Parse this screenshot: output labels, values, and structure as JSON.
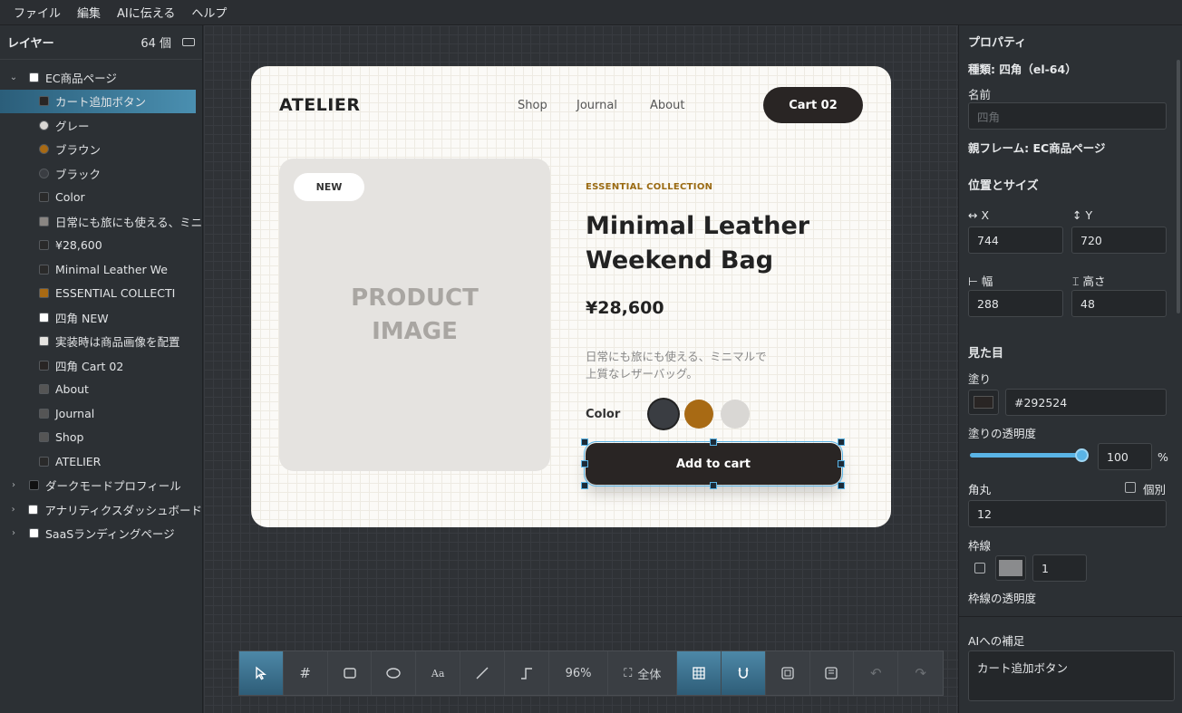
{
  "menu": [
    "ファイル",
    "編集",
    "AIに伝える",
    "ヘルプ"
  ],
  "layers": {
    "title": "レイヤー",
    "count": "64 個",
    "items": [
      {
        "label": "EC商品ページ",
        "level": 0,
        "expanded": true,
        "color": "#ffffff"
      },
      {
        "label": "カート追加ボタン",
        "level": 1,
        "selected": true,
        "color": "#292524"
      },
      {
        "label": "グレー",
        "level": 1,
        "color": "#d9d7d4",
        "round": true
      },
      {
        "label": "ブラウン",
        "level": 1,
        "color": "#a86a14",
        "round": true
      },
      {
        "label": "ブラック",
        "level": 1,
        "color": "#3a3d42",
        "round": true
      },
      {
        "label": "Color",
        "level": 1,
        "color": "#2a2a2a"
      },
      {
        "label": "日常にも旅にも使える、ミニマ",
        "level": 1,
        "color": "#8a8683"
      },
      {
        "label": "¥28,600",
        "level": 1,
        "color": "#2a2a2a"
      },
      {
        "label": "Minimal Leather We",
        "level": 1,
        "color": "#2a2a2a"
      },
      {
        "label": "ESSENTIAL COLLECTI",
        "level": 1,
        "color": "#a86a14"
      },
      {
        "label": "四角 NEW",
        "level": 1,
        "color": "#ffffff"
      },
      {
        "label": "実装時は商品画像を配置",
        "level": 1,
        "color": "#e5e3e0"
      },
      {
        "label": "四角 Cart 02",
        "level": 1,
        "color": "#292524"
      },
      {
        "label": "About",
        "level": 1,
        "color": "#555555"
      },
      {
        "label": "Journal",
        "level": 1,
        "color": "#555555"
      },
      {
        "label": "Shop",
        "level": 1,
        "color": "#555555"
      },
      {
        "label": "ATELIER",
        "level": 1,
        "color": "#2a2a2a"
      },
      {
        "label": "ダークモードプロフィール",
        "level": 0,
        "expanded": false,
        "color": "#111111"
      },
      {
        "label": "アナリティクスダッシュボード",
        "level": 0,
        "expanded": false,
        "color": "#ffffff"
      },
      {
        "label": "SaaSランディングページ",
        "level": 0,
        "expanded": false,
        "color": "#ffffff"
      }
    ]
  },
  "card": {
    "brand": "ATELIER",
    "nav": [
      "Shop",
      "Journal",
      "About"
    ],
    "cart": "Cart  02",
    "badge": "NEW",
    "image_line1": "PRODUCT",
    "image_line2": "IMAGE",
    "collection": "ESSENTIAL COLLECTION",
    "title_line1": "Minimal Leather",
    "title_line2": "Weekend Bag",
    "price": "¥28,600",
    "desc_line1": "日常にも旅にも使える、ミニマルで",
    "desc_line2": "上質なレザーバッグ。",
    "color_label": "Color",
    "swatches": [
      "#3a3d42",
      "#a86a14",
      "#d9d7d4"
    ],
    "add_to_cart": "Add to cart"
  },
  "toolbar": {
    "zoom": "96%",
    "fit": "全体"
  },
  "props": {
    "title": "プロパティ",
    "kind": "種類: 四角（el-64）",
    "name_label": "名前",
    "name_placeholder": "四角",
    "parent": "親フレーム: EC商品ページ",
    "pos_title": "位置とサイズ",
    "x_label": "↔ X",
    "y_label": "↕ Y",
    "x": "744",
    "y": "720",
    "w_label": "⊢ 幅",
    "h_label": "⌶ 高さ",
    "w": "288",
    "h": "48",
    "look_title": "見た目",
    "fill_label": "塗り",
    "fill": "#292524",
    "fill_opacity_label": "塗りの透明度",
    "fill_opacity": "100",
    "percent": "%",
    "radius_label": "角丸",
    "individual": "個別",
    "radius": "12",
    "border_label": "枠線",
    "border_width": "1",
    "border_opacity_label": "枠線の透明度",
    "ai_label": "AIへの補足",
    "ai_note": "カート追加ボタン"
  }
}
